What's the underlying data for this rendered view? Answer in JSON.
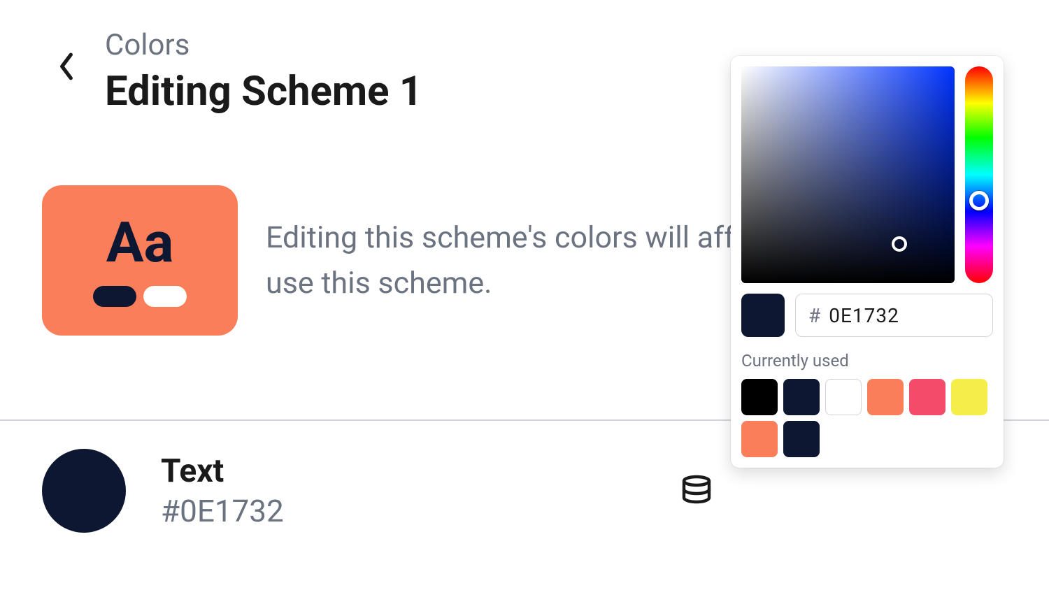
{
  "header": {
    "breadcrumb": "Colors",
    "title": "Editing Scheme 1"
  },
  "info": {
    "preview_text": "Aa",
    "preview_bg": "#fb7e5a",
    "preview_text_color": "#0e1732",
    "pill_dark": "#0e1732",
    "pill_white": "#ffffff",
    "description": "Editing this scheme's colors will affect all sections that use this scheme."
  },
  "color_row": {
    "name": "Text",
    "hex": "#0E1732",
    "swatch_color": "#0e1732"
  },
  "picker": {
    "current_color": "#0e1732",
    "hex_prefix": "#",
    "hex_value": "0E1732",
    "currently_used_label": "Currently used",
    "swatches": [
      "#000000",
      "#0e1732",
      "#ffffff",
      "#fb7e5a",
      "#f54b6a",
      "#f5ee4a",
      "#fb7e5a",
      "#0e1732"
    ]
  }
}
